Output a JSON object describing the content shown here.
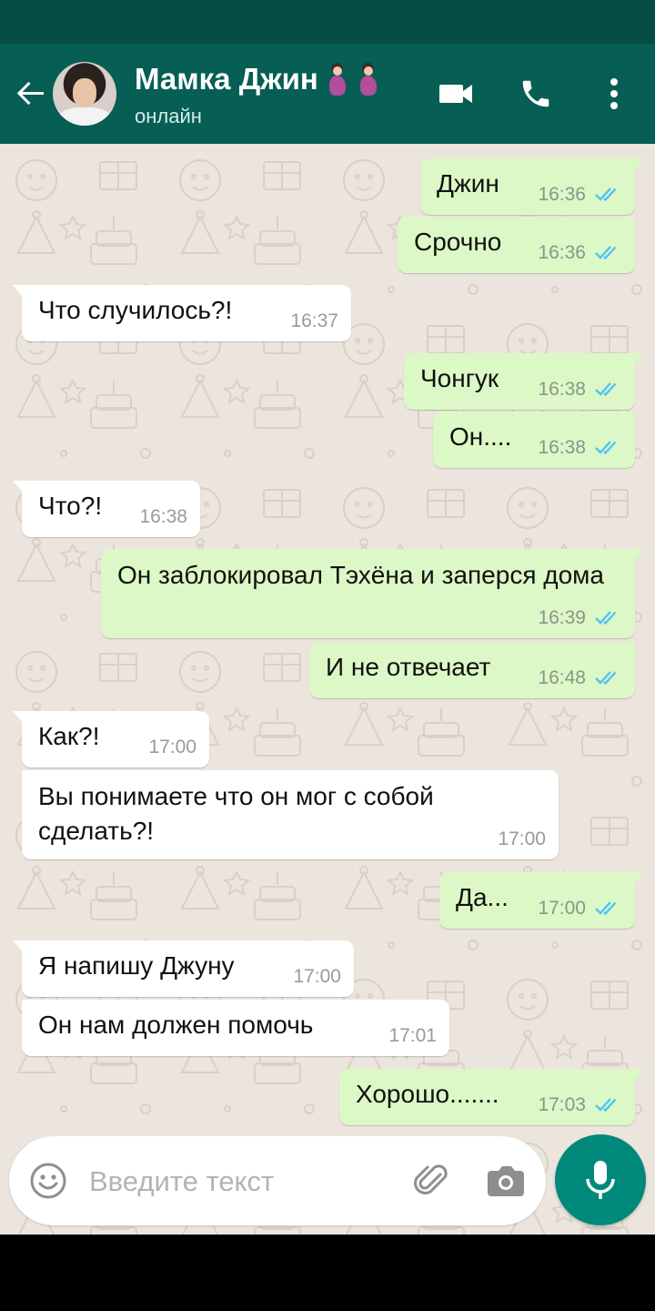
{
  "header": {
    "contact_name": "Мамка Джин",
    "contact_emoji": [
      "pregnant-woman-emoji",
      "pregnant-woman-emoji"
    ],
    "status": "онлайн",
    "icons": [
      "back-arrow-icon",
      "video-call-icon",
      "phone-icon",
      "more-vert-icon"
    ]
  },
  "messages": [
    {
      "dir": "out",
      "text": "Джин",
      "time": "16:36",
      "read": true
    },
    {
      "dir": "out",
      "text": "Срочно",
      "time": "16:36",
      "read": true
    },
    {
      "dir": "in",
      "text": "Что случилось?!",
      "time": "16:37"
    },
    {
      "dir": "out",
      "text": "Чонгук",
      "time": "16:38",
      "read": true
    },
    {
      "dir": "out",
      "text": "Он....",
      "time": "16:38",
      "read": true
    },
    {
      "dir": "in",
      "text": "Что?!",
      "time": "16:38"
    },
    {
      "dir": "out",
      "text": "Он заблокировал Тэхёна и заперся дома",
      "time": "16:39",
      "read": true
    },
    {
      "dir": "out",
      "text": "И не отвечает",
      "time": "16:48",
      "read": true
    },
    {
      "dir": "in",
      "text": "Как?!",
      "time": "17:00"
    },
    {
      "dir": "in",
      "text": "Вы понимаете что он мог с собой сделать?!",
      "time": "17:00"
    },
    {
      "dir": "out",
      "text": "Да...",
      "time": "17:00",
      "read": true
    },
    {
      "dir": "in",
      "text": "Я напишу Джуну",
      "time": "17:00"
    },
    {
      "dir": "in",
      "text": "Он нам должен помочь",
      "time": "17:01"
    },
    {
      "dir": "out",
      "text": "Хорошо.......",
      "time": "17:03",
      "read": true
    }
  ],
  "composer": {
    "placeholder": "Введите текст",
    "icons": [
      "emoji-icon",
      "attach-icon",
      "camera-icon",
      "mic-icon"
    ]
  },
  "colors": {
    "header": "#075e54",
    "statusbar": "#054d44",
    "outgoing_bubble": "#dcf8c6",
    "incoming_bubble": "#ffffff",
    "chat_background": "#ece5dd",
    "read_ticks": "#4fc3f7",
    "mic_button": "#00897b"
  }
}
